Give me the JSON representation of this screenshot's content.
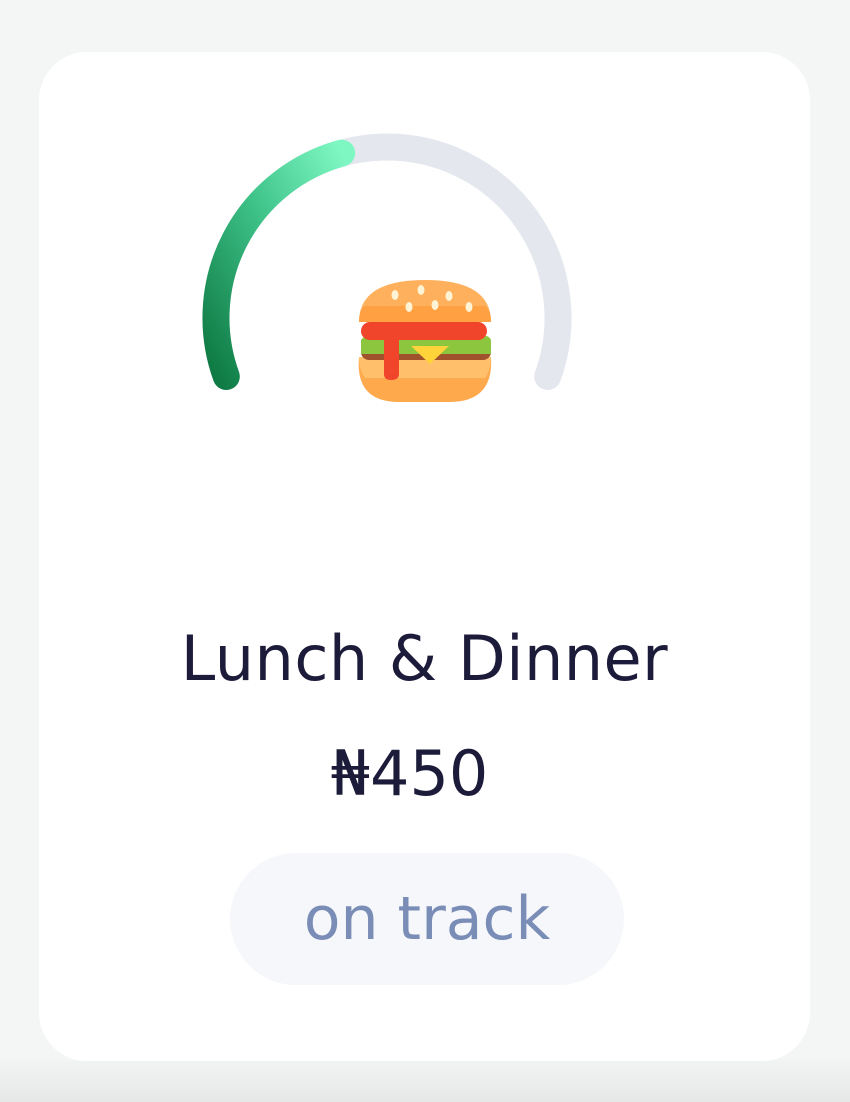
{
  "budget": {
    "category": "Lunch & Dinner",
    "amount": "₦450",
    "status": "on track",
    "progress_fraction": 0.43,
    "icon": "burger-icon"
  },
  "colors": {
    "progress_start": "#0f7a44",
    "progress_end": "#7ff7c3",
    "track": "#e4e7ee",
    "text_primary": "#1d1b3a",
    "status_text": "#7a8db7",
    "pill_bg": "#f6f7fa"
  }
}
